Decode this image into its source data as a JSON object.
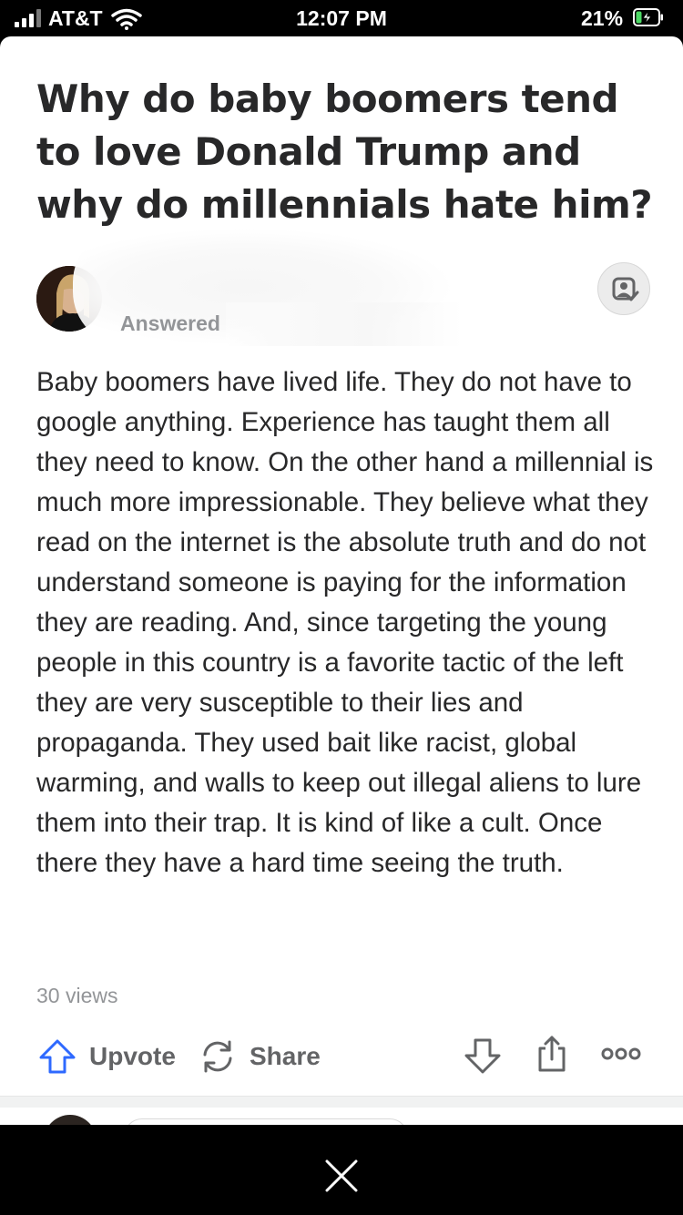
{
  "status_bar": {
    "carrier": "AT&T",
    "time": "12:07 PM",
    "battery_percent": "21%",
    "battery_level": 0.21,
    "charging": true
  },
  "question": {
    "title": "Why do baby boomers tend to love Donald Trump and why do millennials hate him?"
  },
  "answer": {
    "answered_label": "Answered",
    "body": "Baby boomers have lived life. They do not have to google anything. Experience has taught them all they need to know. On the other hand a millennial is much more impressionable. They believe what they read on the internet is the absolute truth and do not understand someone is paying for the information they are reading. And, since targeting the young people in this country is a favorite tactic of the left they are very susceptible to their lies and propaganda. They used bait like racist, global warming, and walls to keep out illegal aliens to lure them into their trap. It is kind of like a cult. Once there they have a hard time seeing the truth.",
    "views": "30 views"
  },
  "actions": {
    "upvote_label": "Upvote",
    "share_label": "Share"
  },
  "icons": {
    "upvote": "upvote-arrow-icon",
    "share": "share-cycle-icon",
    "downvote": "downvote-arrow-icon",
    "export": "export-icon",
    "more": "more-dots-icon",
    "follow": "follow-person-icon",
    "close": "close-icon"
  },
  "colors": {
    "accent_blue": "#2e69ff",
    "text_primary": "#282829",
    "text_secondary": "#939598",
    "action_gray": "#636466"
  }
}
